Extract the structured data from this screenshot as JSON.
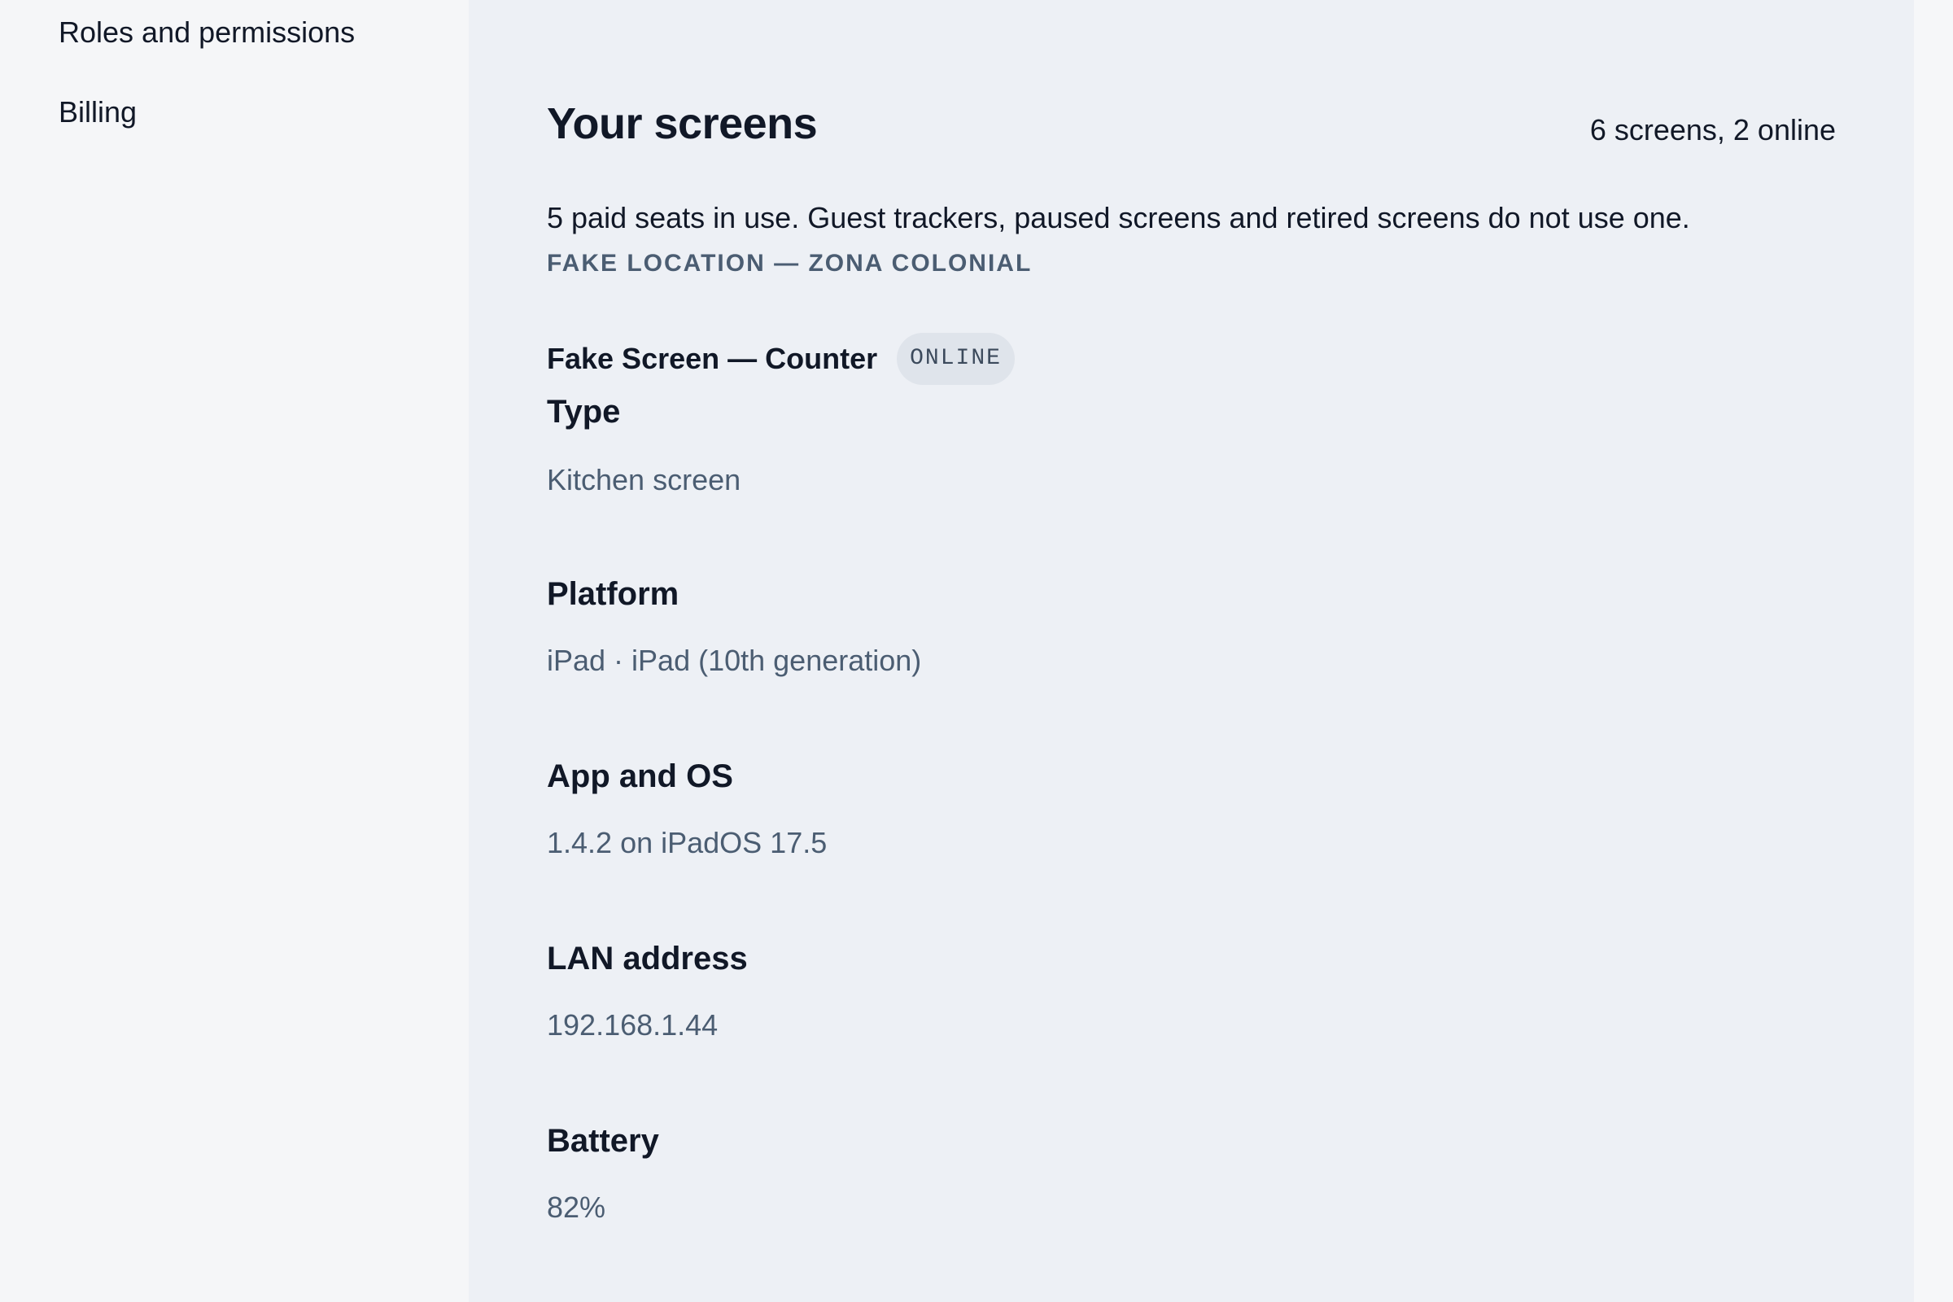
{
  "sidebar": {
    "items": [
      {
        "label": "Roles and permissions"
      },
      {
        "label": "Billing"
      }
    ]
  },
  "main": {
    "title": "Your screens",
    "screen_count": "6 screens, 2 online",
    "seats_note": "5 paid seats in use. Guest trackers, paused screens and retired screens do not use one.",
    "location": "FAKE LOCATION — ZONA COLONIAL",
    "screen": {
      "name": "Fake Screen — Counter",
      "status": "ONLINE",
      "fields": {
        "type": {
          "label": "Type",
          "value": "Kitchen screen"
        },
        "platform": {
          "label": "Platform",
          "value": "iPad · iPad (10th generation)"
        },
        "app_os": {
          "label": "App and OS",
          "value": "1.4.2 on iPadOS 17.5"
        },
        "lan": {
          "label": "LAN address",
          "value": "192.168.1.44"
        },
        "battery": {
          "label": "Battery",
          "value": "82%"
        }
      }
    }
  }
}
